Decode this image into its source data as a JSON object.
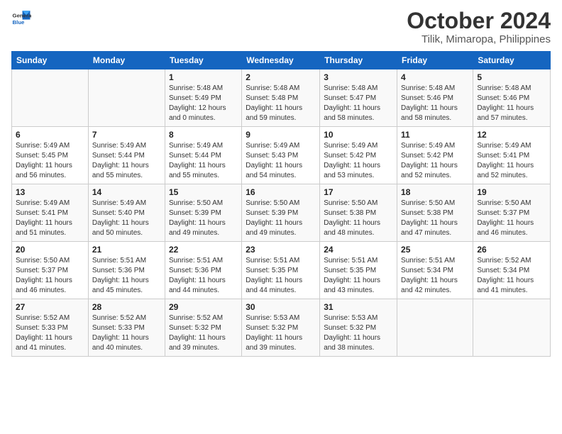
{
  "header": {
    "logo_line1": "General",
    "logo_line2": "Blue",
    "title": "October 2024",
    "location": "Tilik, Mimaropa, Philippines"
  },
  "weekdays": [
    "Sunday",
    "Monday",
    "Tuesday",
    "Wednesday",
    "Thursday",
    "Friday",
    "Saturday"
  ],
  "weeks": [
    [
      null,
      null,
      {
        "day": 1,
        "sunrise": "5:48 AM",
        "sunset": "5:49 PM",
        "daylight": "12 hours and 0 minutes."
      },
      {
        "day": 2,
        "sunrise": "5:48 AM",
        "sunset": "5:48 PM",
        "daylight": "11 hours and 59 minutes."
      },
      {
        "day": 3,
        "sunrise": "5:48 AM",
        "sunset": "5:47 PM",
        "daylight": "11 hours and 58 minutes."
      },
      {
        "day": 4,
        "sunrise": "5:48 AM",
        "sunset": "5:46 PM",
        "daylight": "11 hours and 58 minutes."
      },
      {
        "day": 5,
        "sunrise": "5:48 AM",
        "sunset": "5:46 PM",
        "daylight": "11 hours and 57 minutes."
      }
    ],
    [
      {
        "day": 6,
        "sunrise": "5:49 AM",
        "sunset": "5:45 PM",
        "daylight": "11 hours and 56 minutes."
      },
      {
        "day": 7,
        "sunrise": "5:49 AM",
        "sunset": "5:44 PM",
        "daylight": "11 hours and 55 minutes."
      },
      {
        "day": 8,
        "sunrise": "5:49 AM",
        "sunset": "5:44 PM",
        "daylight": "11 hours and 55 minutes."
      },
      {
        "day": 9,
        "sunrise": "5:49 AM",
        "sunset": "5:43 PM",
        "daylight": "11 hours and 54 minutes."
      },
      {
        "day": 10,
        "sunrise": "5:49 AM",
        "sunset": "5:42 PM",
        "daylight": "11 hours and 53 minutes."
      },
      {
        "day": 11,
        "sunrise": "5:49 AM",
        "sunset": "5:42 PM",
        "daylight": "11 hours and 52 minutes."
      },
      {
        "day": 12,
        "sunrise": "5:49 AM",
        "sunset": "5:41 PM",
        "daylight": "11 hours and 52 minutes."
      }
    ],
    [
      {
        "day": 13,
        "sunrise": "5:49 AM",
        "sunset": "5:41 PM",
        "daylight": "11 hours and 51 minutes."
      },
      {
        "day": 14,
        "sunrise": "5:49 AM",
        "sunset": "5:40 PM",
        "daylight": "11 hours and 50 minutes."
      },
      {
        "day": 15,
        "sunrise": "5:50 AM",
        "sunset": "5:39 PM",
        "daylight": "11 hours and 49 minutes."
      },
      {
        "day": 16,
        "sunrise": "5:50 AM",
        "sunset": "5:39 PM",
        "daylight": "11 hours and 49 minutes."
      },
      {
        "day": 17,
        "sunrise": "5:50 AM",
        "sunset": "5:38 PM",
        "daylight": "11 hours and 48 minutes."
      },
      {
        "day": 18,
        "sunrise": "5:50 AM",
        "sunset": "5:38 PM",
        "daylight": "11 hours and 47 minutes."
      },
      {
        "day": 19,
        "sunrise": "5:50 AM",
        "sunset": "5:37 PM",
        "daylight": "11 hours and 46 minutes."
      }
    ],
    [
      {
        "day": 20,
        "sunrise": "5:50 AM",
        "sunset": "5:37 PM",
        "daylight": "11 hours and 46 minutes."
      },
      {
        "day": 21,
        "sunrise": "5:51 AM",
        "sunset": "5:36 PM",
        "daylight": "11 hours and 45 minutes."
      },
      {
        "day": 22,
        "sunrise": "5:51 AM",
        "sunset": "5:36 PM",
        "daylight": "11 hours and 44 minutes."
      },
      {
        "day": 23,
        "sunrise": "5:51 AM",
        "sunset": "5:35 PM",
        "daylight": "11 hours and 44 minutes."
      },
      {
        "day": 24,
        "sunrise": "5:51 AM",
        "sunset": "5:35 PM",
        "daylight": "11 hours and 43 minutes."
      },
      {
        "day": 25,
        "sunrise": "5:51 AM",
        "sunset": "5:34 PM",
        "daylight": "11 hours and 42 minutes."
      },
      {
        "day": 26,
        "sunrise": "5:52 AM",
        "sunset": "5:34 PM",
        "daylight": "11 hours and 41 minutes."
      }
    ],
    [
      {
        "day": 27,
        "sunrise": "5:52 AM",
        "sunset": "5:33 PM",
        "daylight": "11 hours and 41 minutes."
      },
      {
        "day": 28,
        "sunrise": "5:52 AM",
        "sunset": "5:33 PM",
        "daylight": "11 hours and 40 minutes."
      },
      {
        "day": 29,
        "sunrise": "5:52 AM",
        "sunset": "5:32 PM",
        "daylight": "11 hours and 39 minutes."
      },
      {
        "day": 30,
        "sunrise": "5:53 AM",
        "sunset": "5:32 PM",
        "daylight": "11 hours and 39 minutes."
      },
      {
        "day": 31,
        "sunrise": "5:53 AM",
        "sunset": "5:32 PM",
        "daylight": "11 hours and 38 minutes."
      },
      null,
      null
    ]
  ],
  "labels": {
    "sunrise": "Sunrise:",
    "sunset": "Sunset:",
    "daylight": "Daylight:"
  }
}
